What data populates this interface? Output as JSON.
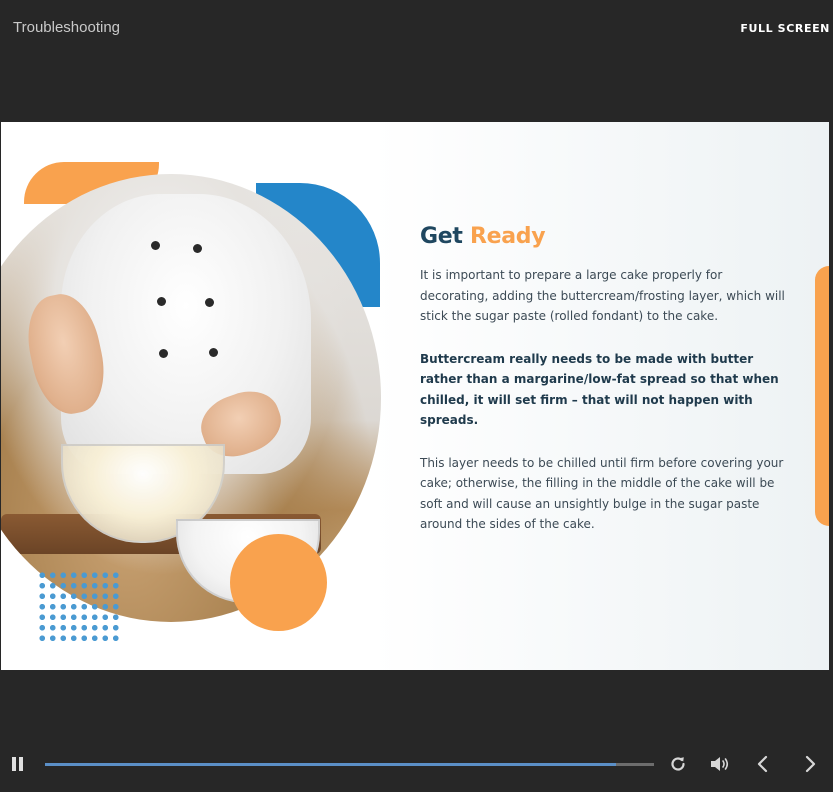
{
  "header": {
    "title": "Troubleshooting",
    "fullscreen_label": "FULL SCREEN"
  },
  "slide": {
    "heading_part1": "Get ",
    "heading_part2": "Ready",
    "paragraphs": [
      "It is important to prepare a large cake properly for decorating, adding the buttercream/frosting layer, which will stick the sugar paste (rolled fondant) to the cake.",
      "Buttercream really needs to be made with butter rather than a margarine/low-fat spread so that when chilled, it will set firm – that will not happen with spreads.",
      "This layer needs to be chilled until firm before covering your cake; otherwise, the filling in the middle of the cake will be soft and will cause an unsightly bulge in the sugar paste around the sides of the cake."
    ],
    "colors": {
      "accent_orange": "#f9a24e",
      "accent_blue": "#2486c9",
      "heading_navy": "#1f4760"
    }
  },
  "player": {
    "progress_fraction": 0.938,
    "icons": [
      "pause-icon",
      "replay-icon",
      "volume-icon",
      "chevron-left-icon",
      "chevron-right-icon"
    ]
  }
}
